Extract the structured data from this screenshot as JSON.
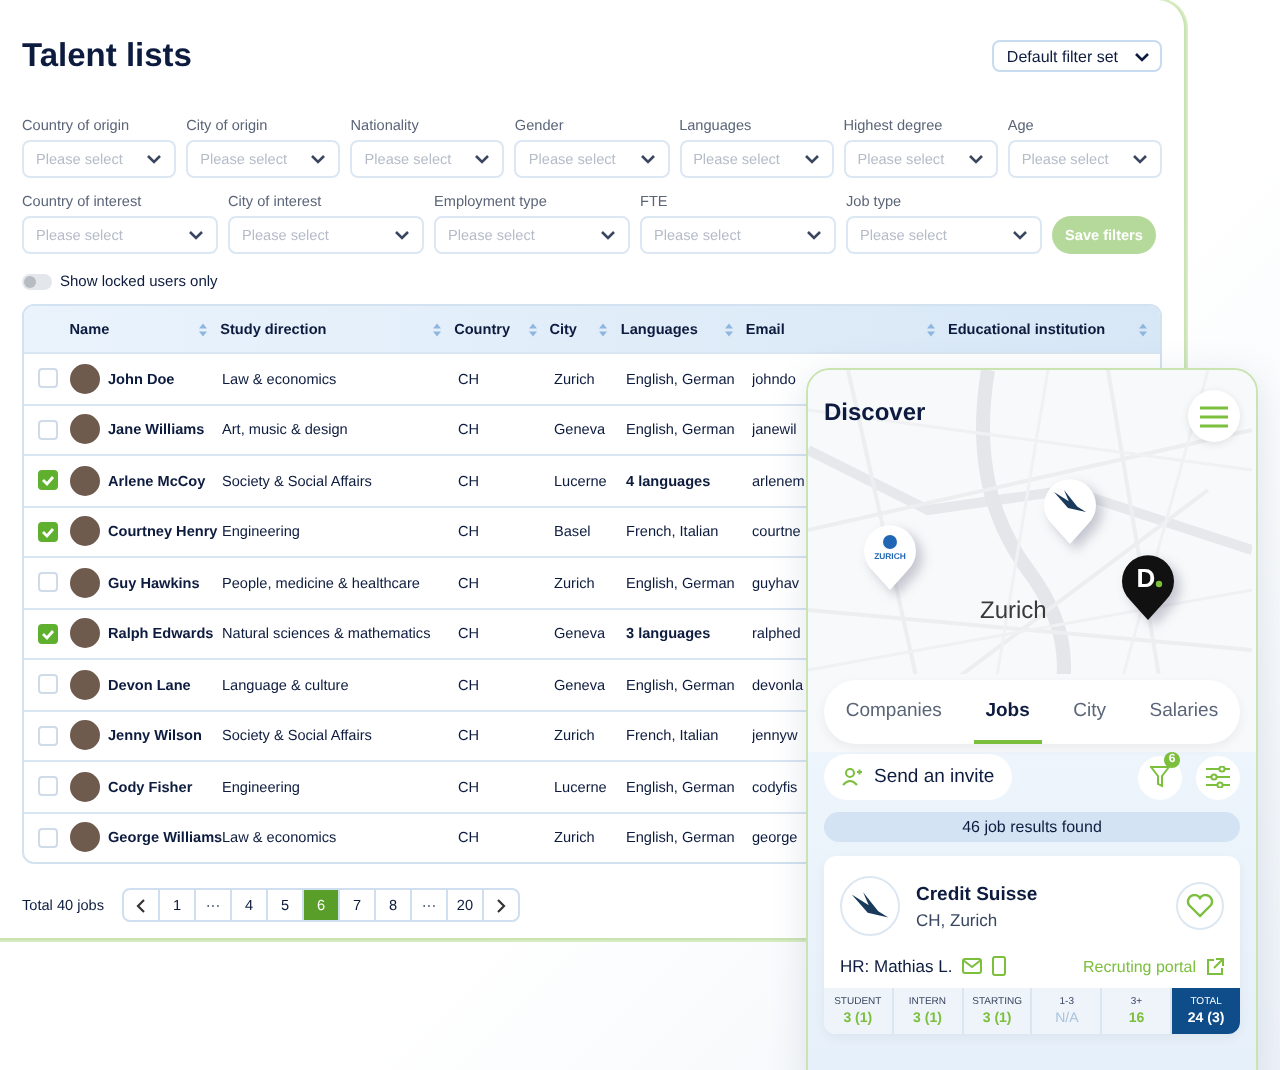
{
  "title": "Talent lists",
  "filter_set": {
    "value": "Default filter set"
  },
  "filters_row_1": [
    {
      "label": "Country of origin",
      "placeholder": "Please select"
    },
    {
      "label": "City of origin",
      "placeholder": "Please select"
    },
    {
      "label": "Nationality",
      "placeholder": "Please select"
    },
    {
      "label": "Gender",
      "placeholder": "Please select"
    },
    {
      "label": "Languages",
      "placeholder": "Please select"
    },
    {
      "label": "Highest degree",
      "placeholder": "Please select"
    },
    {
      "label": "Age",
      "placeholder": "Please select"
    }
  ],
  "filters_row_2": [
    {
      "label": "Country of interest",
      "placeholder": "Please select"
    },
    {
      "label": "City of interest",
      "placeholder": "Please select"
    },
    {
      "label": "Employment type",
      "placeholder": "Please select"
    },
    {
      "label": "FTE",
      "placeholder": "Please select"
    },
    {
      "label": "Job type",
      "placeholder": "Please select"
    }
  ],
  "save_button": {
    "label": "Save filters",
    "disabled": true
  },
  "locked_toggle": {
    "label": "Show locked users only",
    "on": false
  },
  "table": {
    "columns": [
      "Name",
      "Study direction",
      "Country",
      "City",
      "Languages",
      "Email",
      "Educational institution"
    ],
    "rows": [
      {
        "selected": false,
        "name": "John Doe",
        "study": "Law & economics",
        "country": "CH",
        "city": "Zurich",
        "languages": "English, German",
        "languages_summarized": false,
        "email": "johndo"
      },
      {
        "selected": false,
        "name": "Jane Williams",
        "study": "Art, music & design",
        "country": "CH",
        "city": "Geneva",
        "languages": "English, German",
        "languages_summarized": false,
        "email": "janewil"
      },
      {
        "selected": true,
        "name": "Arlene McCoy",
        "study": "Society & Social Affairs",
        "country": "CH",
        "city": "Lucerne",
        "languages": "4 languages",
        "languages_summarized": true,
        "email": "arlenem"
      },
      {
        "selected": true,
        "name": "Courtney Henry",
        "study": "Engineering",
        "country": "CH",
        "city": "Basel",
        "languages": "French, Italian",
        "languages_summarized": false,
        "email": "courtne"
      },
      {
        "selected": false,
        "name": "Guy Hawkins",
        "study": "People, medicine & healthcare",
        "country": "CH",
        "city": "Zurich",
        "languages": "English, German",
        "languages_summarized": false,
        "email": "guyhav"
      },
      {
        "selected": true,
        "name": "Ralph Edwards",
        "study": "Natural sciences & mathematics",
        "country": "CH",
        "city": "Geneva",
        "languages": "3 languages",
        "languages_summarized": true,
        "email": "ralphed"
      },
      {
        "selected": false,
        "name": "Devon Lane",
        "study": "Language & culture",
        "country": "CH",
        "city": "Geneva",
        "languages": "English, German",
        "languages_summarized": false,
        "email": "devonla"
      },
      {
        "selected": false,
        "name": "Jenny Wilson",
        "study": "Society & Social Affairs",
        "country": "CH",
        "city": "Zurich",
        "languages": "French, Italian",
        "languages_summarized": false,
        "email": "jennyw"
      },
      {
        "selected": false,
        "name": "Cody Fisher",
        "study": "Engineering",
        "country": "CH",
        "city": "Lucerne",
        "languages": "English, German",
        "languages_summarized": false,
        "email": "codyfis"
      },
      {
        "selected": false,
        "name": "George Williams",
        "study": "Law & economics",
        "country": "CH",
        "city": "Zurich",
        "languages": "English, German",
        "languages_summarized": false,
        "email": "george"
      }
    ]
  },
  "total": "Total 40 jobs",
  "pagination": [
    {
      "label": "1",
      "selected": false
    },
    {
      "label": "···",
      "selected": false
    },
    {
      "label": "4",
      "selected": false
    },
    {
      "label": "5",
      "selected": false
    },
    {
      "label": "6",
      "selected": true
    },
    {
      "label": "7",
      "selected": false
    },
    {
      "label": "8",
      "selected": false
    },
    {
      "label": "···",
      "selected": false
    },
    {
      "label": "20",
      "selected": false
    }
  ],
  "discover": {
    "title": "Discover",
    "map_label": "Zurich",
    "pins": [
      {
        "kind": "zurich",
        "label": "ZURICH"
      },
      {
        "kind": "sail"
      },
      {
        "kind": "letter",
        "label": "D"
      }
    ],
    "tabs": [
      {
        "label": "Companies",
        "selected": false
      },
      {
        "label": "Jobs",
        "selected": true
      },
      {
        "label": "City",
        "selected": false
      },
      {
        "label": "Salaries",
        "selected": false
      }
    ],
    "invite_button": "Send an invite",
    "filter_count": "6",
    "results": "46 job results found",
    "job": {
      "company": "Credit Suisse",
      "location": "CH, Zurich",
      "hr": "HR: Mathias L.",
      "portal": "Recruting portal",
      "stats": [
        {
          "label": "STUDENT",
          "value": "3 (1)",
          "muted": false,
          "selected": false
        },
        {
          "label": "INTERN",
          "value": "3 (1)",
          "muted": false,
          "selected": false
        },
        {
          "label": "STARTING",
          "value": "3 (1)",
          "muted": false,
          "selected": false
        },
        {
          "label": "1-3",
          "value": "N/A",
          "muted": true,
          "selected": false
        },
        {
          "label": "3+",
          "value": "16",
          "muted": false,
          "selected": false
        },
        {
          "label": "TOTAL",
          "value": "24 (3)",
          "muted": false,
          "selected": true
        }
      ]
    }
  }
}
